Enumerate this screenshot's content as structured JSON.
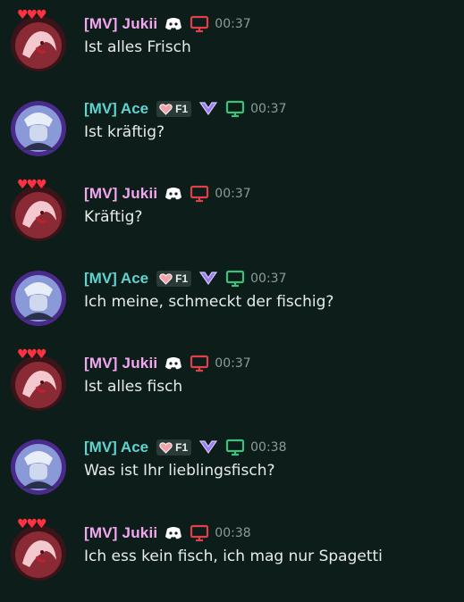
{
  "icons": {
    "bot": "discord-logo-icon",
    "platform": "desktop-monitor-icon",
    "server_tag": "heart-icon",
    "boost": "nitro-chevron-icon"
  },
  "colors": {
    "background": "#0c1d1a",
    "jukii_name": "#f2a7f0",
    "ace_name": "#5fd4d0",
    "jukii_monitor": "#e0404a",
    "ace_monitor": "#3ec27a",
    "timestamp": "#8a9d98",
    "message_text": "#e6ecea"
  },
  "messages": [
    {
      "author": "[MV] Jukii",
      "time": "00:37",
      "text": "Ist alles Frisch"
    },
    {
      "author": "[MV] Ace",
      "tag": "F1",
      "time": "00:37",
      "text": "Ist kräftig?"
    },
    {
      "author": "[MV] Jukii",
      "time": "00:37",
      "text": "Kräftig?"
    },
    {
      "author": "[MV] Ace",
      "tag": "F1",
      "time": "00:37",
      "text": "Ich meine, schmeckt der fischig?"
    },
    {
      "author": "[MV] Jukii",
      "time": "00:37",
      "text": "Ist alles fisch"
    },
    {
      "author": "[MV] Ace",
      "tag": "F1",
      "time": "00:38",
      "text": "Was ist Ihr lieblingsfisch?"
    },
    {
      "author": "[MV] Jukii",
      "time": "00:38",
      "text": "Ich ess kein fisch, ich mag nur Spagetti"
    }
  ]
}
